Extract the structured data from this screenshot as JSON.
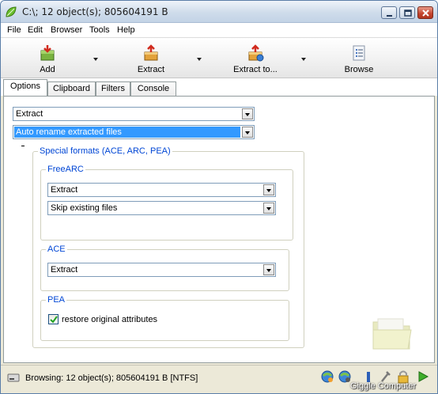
{
  "window": {
    "title": "C:\\; 12 object(s); 805604191 B"
  },
  "menu": [
    "File",
    "Edit",
    "Browser",
    "Tools",
    "Help"
  ],
  "toolbar": {
    "add_label": "Add",
    "extract_label": "Extract",
    "extract_to_label": "Extract to...",
    "browse_label": "Browse"
  },
  "tabs": [
    "Options",
    "Clipboard",
    "Filters",
    "Console"
  ],
  "options": {
    "action_value": "Extract",
    "overwrite_value": "Auto rename extracted files",
    "special_formats_title": "Special formats (ACE, ARC, PEA)",
    "freearc": {
      "title": "FreeARC",
      "action_value": "Extract",
      "overwrite_value": "Skip existing files"
    },
    "ace": {
      "title": "ACE",
      "action_value": "Extract"
    },
    "pea": {
      "title": "PEA",
      "restore_label": "restore original attributes",
      "restore_checked": true
    }
  },
  "status": {
    "text": "Browsing: 12 object(s); 805604191 B [NTFS]",
    "brand": "Giggle Computer"
  },
  "colors": {
    "group_title": "#0046d5",
    "selection": "#3399ff",
    "window_face": "#ece9d8"
  }
}
